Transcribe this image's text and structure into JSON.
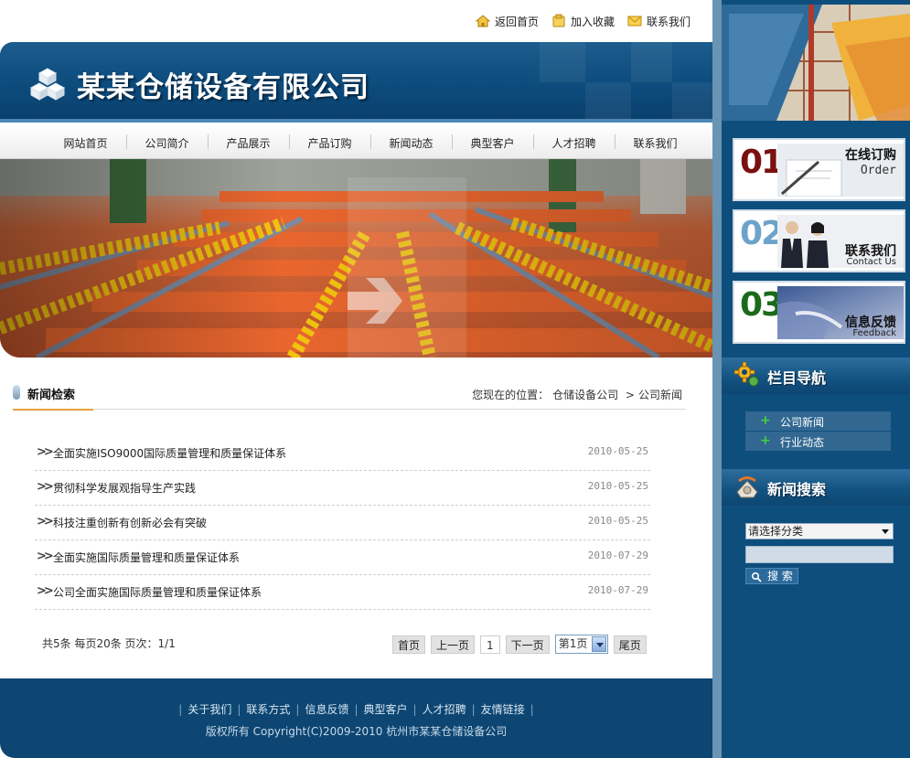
{
  "header": {
    "links": [
      {
        "label": "返回首页",
        "icon": "home-icon"
      },
      {
        "label": "加入收藏",
        "icon": "bookmark-icon"
      },
      {
        "label": "联系我们",
        "icon": "mail-icon"
      }
    ],
    "company_name": "某某仓储设备有限公司"
  },
  "nav": {
    "items": [
      "网站首页",
      "公司简介",
      "产品展示",
      "产品订购",
      "新闻动态",
      "典型客户",
      "人才招聘",
      "联系我们"
    ]
  },
  "news": {
    "section_title": "新闻检索",
    "breadcrumb_prefix": "您现在的位置：",
    "breadcrumb_home": "仓储设备公司",
    "breadcrumb_sep": ">",
    "breadcrumb_current": "公司新闻",
    "items": [
      {
        "title": "全面实施ISO9000国际质量管理和质量保证体系",
        "date": "2010-05-25"
      },
      {
        "title": "贯彻科学发展观指导生产实践",
        "date": "2010-05-25"
      },
      {
        "title": "科技注重创新有创新必会有突破",
        "date": "2010-05-25"
      },
      {
        "title": "全面实施国际质量管理和质量保证体系",
        "date": "2010-07-29"
      },
      {
        "title": "公司全面实施国际质量管理和质量保证体系",
        "date": "2010-07-29"
      }
    ],
    "pageinfo": "共5条  每页20条  页次：1/1"
  },
  "pager": {
    "first": "首页",
    "prev": "上一页",
    "current": "1",
    "next": "下一页",
    "select_value": "第1页",
    "last": "尾页"
  },
  "footer": {
    "links": [
      "关于我们",
      "联系方式",
      "信息反馈",
      "典型客户",
      "人才招聘",
      "友情链接"
    ],
    "copyright": "版权所有  Copyright(C)2009-2010 杭州市某某仓储设备公司"
  },
  "sidebar": {
    "cards": [
      {
        "num": "01",
        "cn": "在线订购",
        "en": "Order",
        "color": "#7a1010"
      },
      {
        "num": "02",
        "cn": "联系我们",
        "en": "Contact Us",
        "color": "#6ea3c9"
      },
      {
        "num": "03",
        "cn": "信息反馈",
        "en": "Feedback",
        "color": "#1b6a1b"
      }
    ],
    "column_nav_title": "栏目导航",
    "column_nav_items": [
      "公司新闻",
      "行业动态"
    ],
    "search_title": "新闻搜索",
    "search_select": "请选择分类",
    "search_button": "搜 索"
  }
}
